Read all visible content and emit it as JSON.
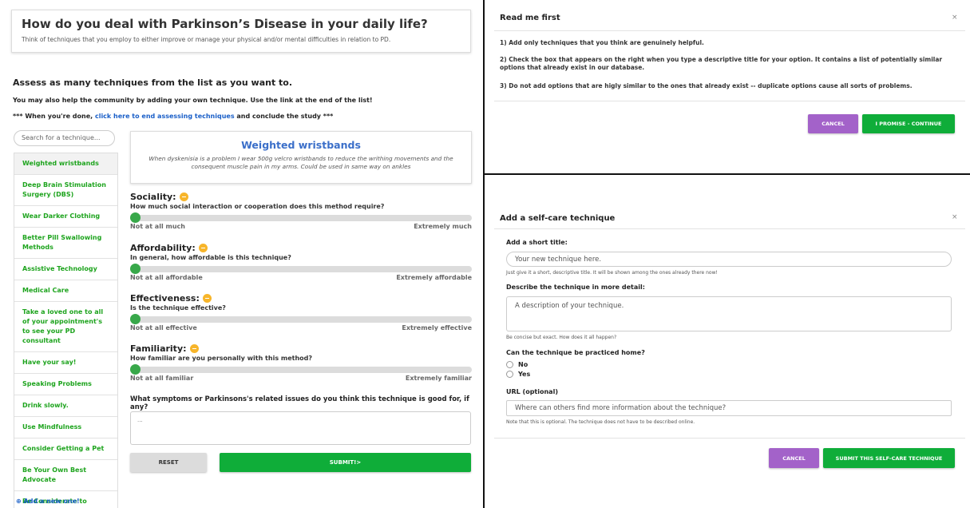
{
  "left": {
    "header_title": "How do you deal with Parkinson’s Disease in your daily life?",
    "header_subtitle": "Think of techniques that you employ to either improve or manage your physical and/or mental difficulties in relation to PD.",
    "assess_heading": "Assess as many techniques from the list as you want to.",
    "community_text": "You may also help the community by adding your own technique. Use the link at the end of the list!",
    "done_prefix": "*** When you're done, ",
    "done_link": "click here to end assessing techniques",
    "done_suffix": " and conclude the study ***",
    "search_placeholder": "Search for a technique...",
    "techniques": [
      "Weighted wristbands",
      "Deep Brain Stimulation Surgery (DBS)",
      "Wear Darker Clothing",
      "Better Pill Swallowing Methods",
      "Assistive Technology",
      "Medical Care",
      "Take a loved one to all of your appointment's to see your PD consultant",
      "Have your say!",
      "Speaking Problems",
      "Drink slowly.",
      "Use Mindfulness",
      "Consider Getting a Pet",
      "Be Your Own Best Advocate",
      "Be Considerate to Those That Help You."
    ],
    "add_new": "Add a new one!",
    "selected": {
      "title": "Weighted wristbands",
      "description": "When dyskenisia is a problem I wear 500g velcro wristbands to reduce the writhing movements and the consequent muscle pain in my arms. Could be used in same way on ankles"
    },
    "ratings": [
      {
        "title": "Sociality:",
        "question": "How much social interaction or cooperation does this method require?",
        "min_label": "Not at all much",
        "max_label": "Extremely much",
        "value": 0
      },
      {
        "title": "Affordability:",
        "question": "In general, how affordable is this technique?",
        "min_label": "Not at all affordable",
        "max_label": "Extremely affordable",
        "value": 0
      },
      {
        "title": "Effectiveness:",
        "question": "Is the technique effective?",
        "min_label": "Not at all effective",
        "max_label": "Extremely effective",
        "value": 0
      },
      {
        "title": "Familiarity:",
        "question": "How familiar are you personally with this method?",
        "min_label": "Not at all familiar",
        "max_label": "Extremely familiar",
        "value": 0
      }
    ],
    "symptoms_question": "What symptoms or Parkinsons's related issues do you think this technique is good for, if any?",
    "symptoms_placeholder": "...",
    "reset_label": "RESET",
    "submit_label": "SUBMIT!>"
  },
  "readme": {
    "title": "Read me first",
    "close": "×",
    "points": [
      "1) Add only techniques that you think are genuinely helpful.",
      "2) Check the box that appears on the right when you type a descriptive title for your option. It contains a list of potentially similar options that already exist in our database.",
      "3) Do not add options that are higly similar to the ones that already exist -- duplicate options cause all sorts of problems."
    ],
    "cancel_label": "CANCEL",
    "continue_label": "I PROMISE - CONTINUE"
  },
  "add_modal": {
    "title": "Add a self-care technique",
    "close": "×",
    "short_title_label": "Add a short title:",
    "short_title_placeholder": "Your new technique here.",
    "short_title_hint": "Just give it a short, descriptive title. It will be shown among the ones already there now!",
    "describe_label": "Describe the technique in more detail:",
    "describe_placeholder": "A description of your technique.",
    "describe_hint": "Be concise but exact. How does it all happen?",
    "home_label": "Can the technique be practiced home?",
    "home_options": [
      "No",
      "Yes"
    ],
    "url_label": "URL (optional)",
    "url_placeholder": "Where can others find more information about the technique?",
    "url_hint": "Note that this is optional. The technique does not have to be described online.",
    "cancel_label": "CANCEL",
    "submit_label": "SUBMIT THIS SELF-CARE TECHNIQUE"
  },
  "colors": {
    "green": "#1ea41e",
    "button_green": "#0fad39",
    "purple": "#a362c9",
    "link_blue": "#1a5fc8",
    "title_blue": "#3b6fc9",
    "knob_green": "#38a84a",
    "badge_orange": "#f7b52a"
  }
}
